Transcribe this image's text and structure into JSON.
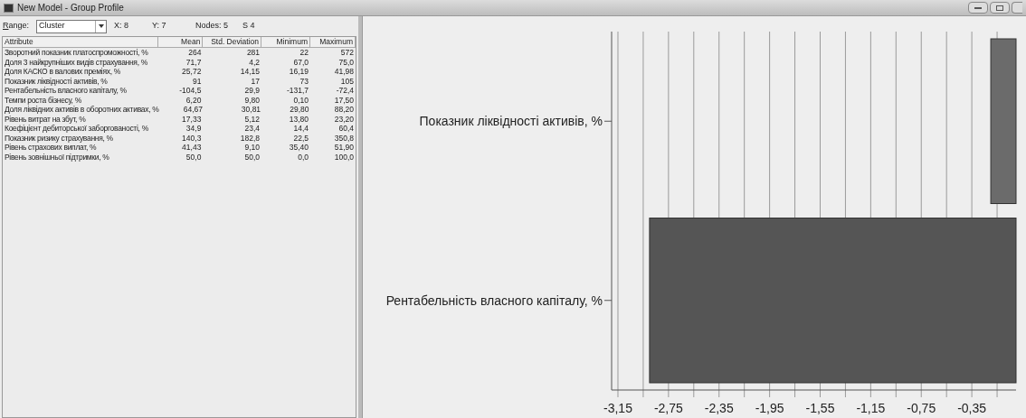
{
  "window": {
    "title": "New Model - Group Profile"
  },
  "toolbar": {
    "range_label": "Range:",
    "range_value": "Cluster",
    "x": "X: 8",
    "y": "Y: 7",
    "nodes": "Nodes: 5",
    "s": "S 4"
  },
  "table": {
    "columns": [
      "Attribute",
      "Mean",
      "Std. Deviation",
      "Minimum",
      "Maximum"
    ],
    "rows": [
      [
        "Зворотний показник платоспроможності, %",
        "264",
        "281",
        "22",
        "572"
      ],
      [
        "Доля 3 найкрупніших видів страхування, %",
        "71,7",
        "4,2",
        "67,0",
        "75,0"
      ],
      [
        "Доля КАСКО в валових преміях, %",
        "25,72",
        "14,15",
        "16,19",
        "41,98"
      ],
      [
        "Показник ліквідності активів, %",
        "91",
        "17",
        "73",
        "105"
      ],
      [
        "Рентабельність власного капіталу, %",
        "-104,5",
        "29,9",
        "-131,7",
        "-72,4"
      ],
      [
        "Темпи роста бізнесу, %",
        "6,20",
        "9,80",
        "0,10",
        "17,50"
      ],
      [
        "Доля ліквідних активів в оборотних активах, %",
        "64,67",
        "30,81",
        "29,80",
        "88,20"
      ],
      [
        "Рівень витрат на збут, %",
        "17,33",
        "5,12",
        "13,80",
        "23,20"
      ],
      [
        "Коефіцієнт дебиторської заборгованості, %",
        "34,9",
        "23,4",
        "14,4",
        "60,4"
      ],
      [
        "Показник ризику страхування, %",
        "140,3",
        "182,8",
        "22,5",
        "350,8"
      ],
      [
        "Рівень страхових виплат, %",
        "41,43",
        "9,10",
        "35,40",
        "51,90"
      ],
      [
        "Рівень зовнішньої підтримки, %",
        "50,0",
        "50,0",
        "0,0",
        "100,0"
      ]
    ]
  },
  "chart": {
    "chart_data": {
      "type": "bar",
      "orientation": "horizontal",
      "grid": true,
      "categories": [
        "Показник ліквідності активів, %",
        "Рентабельність власного капіталу, %"
      ],
      "values": [
        -0.2,
        -2.9
      ],
      "xlim": [
        -3.2,
        0
      ],
      "xticks": [
        {
          "value": -3.15,
          "label": "-3,15"
        },
        {
          "value": -2.75,
          "label": "-2,75"
        },
        {
          "value": -2.35,
          "label": "-2,35"
        },
        {
          "value": -1.95,
          "label": "-1,95"
        },
        {
          "value": -1.55,
          "label": "-1,55"
        },
        {
          "value": -1.15,
          "label": "-1,15"
        },
        {
          "value": -0.75,
          "label": "-0,75"
        },
        {
          "value": -0.35,
          "label": "-0,35"
        }
      ]
    }
  }
}
